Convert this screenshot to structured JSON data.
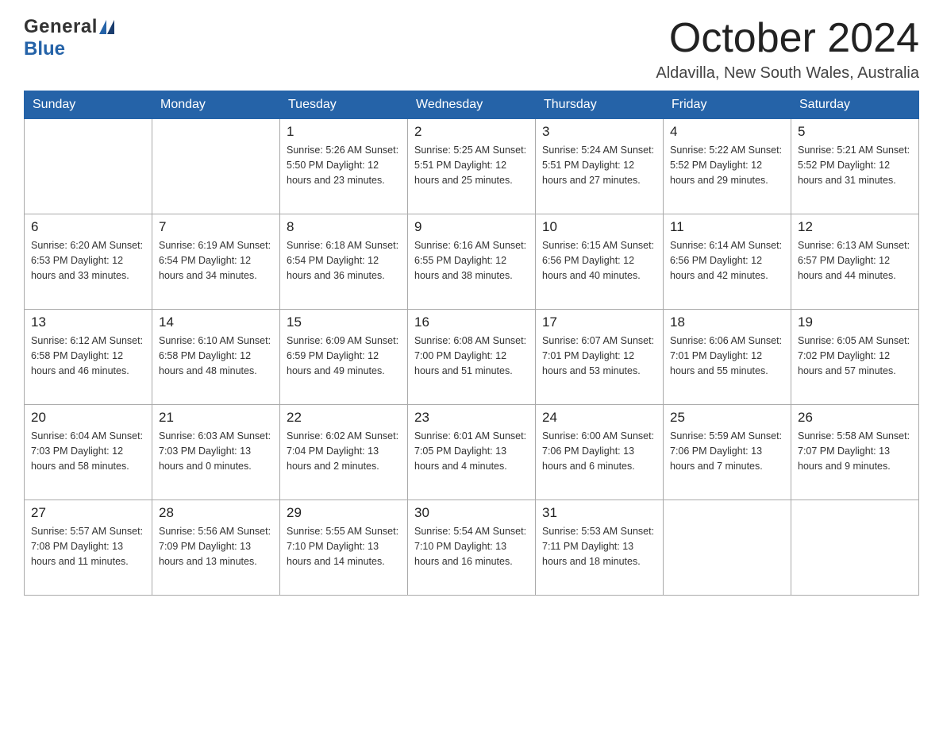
{
  "header": {
    "logo": {
      "text_general": "General",
      "text_blue": "Blue"
    },
    "title": "October 2024",
    "location": "Aldavilla, New South Wales, Australia"
  },
  "weekdays": [
    "Sunday",
    "Monday",
    "Tuesday",
    "Wednesday",
    "Thursday",
    "Friday",
    "Saturday"
  ],
  "weeks": [
    [
      {
        "day": "",
        "info": ""
      },
      {
        "day": "",
        "info": ""
      },
      {
        "day": "1",
        "info": "Sunrise: 5:26 AM\nSunset: 5:50 PM\nDaylight: 12 hours\nand 23 minutes."
      },
      {
        "day": "2",
        "info": "Sunrise: 5:25 AM\nSunset: 5:51 PM\nDaylight: 12 hours\nand 25 minutes."
      },
      {
        "day": "3",
        "info": "Sunrise: 5:24 AM\nSunset: 5:51 PM\nDaylight: 12 hours\nand 27 minutes."
      },
      {
        "day": "4",
        "info": "Sunrise: 5:22 AM\nSunset: 5:52 PM\nDaylight: 12 hours\nand 29 minutes."
      },
      {
        "day": "5",
        "info": "Sunrise: 5:21 AM\nSunset: 5:52 PM\nDaylight: 12 hours\nand 31 minutes."
      }
    ],
    [
      {
        "day": "6",
        "info": "Sunrise: 6:20 AM\nSunset: 6:53 PM\nDaylight: 12 hours\nand 33 minutes."
      },
      {
        "day": "7",
        "info": "Sunrise: 6:19 AM\nSunset: 6:54 PM\nDaylight: 12 hours\nand 34 minutes."
      },
      {
        "day": "8",
        "info": "Sunrise: 6:18 AM\nSunset: 6:54 PM\nDaylight: 12 hours\nand 36 minutes."
      },
      {
        "day": "9",
        "info": "Sunrise: 6:16 AM\nSunset: 6:55 PM\nDaylight: 12 hours\nand 38 minutes."
      },
      {
        "day": "10",
        "info": "Sunrise: 6:15 AM\nSunset: 6:56 PM\nDaylight: 12 hours\nand 40 minutes."
      },
      {
        "day": "11",
        "info": "Sunrise: 6:14 AM\nSunset: 6:56 PM\nDaylight: 12 hours\nand 42 minutes."
      },
      {
        "day": "12",
        "info": "Sunrise: 6:13 AM\nSunset: 6:57 PM\nDaylight: 12 hours\nand 44 minutes."
      }
    ],
    [
      {
        "day": "13",
        "info": "Sunrise: 6:12 AM\nSunset: 6:58 PM\nDaylight: 12 hours\nand 46 minutes."
      },
      {
        "day": "14",
        "info": "Sunrise: 6:10 AM\nSunset: 6:58 PM\nDaylight: 12 hours\nand 48 minutes."
      },
      {
        "day": "15",
        "info": "Sunrise: 6:09 AM\nSunset: 6:59 PM\nDaylight: 12 hours\nand 49 minutes."
      },
      {
        "day": "16",
        "info": "Sunrise: 6:08 AM\nSunset: 7:00 PM\nDaylight: 12 hours\nand 51 minutes."
      },
      {
        "day": "17",
        "info": "Sunrise: 6:07 AM\nSunset: 7:01 PM\nDaylight: 12 hours\nand 53 minutes."
      },
      {
        "day": "18",
        "info": "Sunrise: 6:06 AM\nSunset: 7:01 PM\nDaylight: 12 hours\nand 55 minutes."
      },
      {
        "day": "19",
        "info": "Sunrise: 6:05 AM\nSunset: 7:02 PM\nDaylight: 12 hours\nand 57 minutes."
      }
    ],
    [
      {
        "day": "20",
        "info": "Sunrise: 6:04 AM\nSunset: 7:03 PM\nDaylight: 12 hours\nand 58 minutes."
      },
      {
        "day": "21",
        "info": "Sunrise: 6:03 AM\nSunset: 7:03 PM\nDaylight: 13 hours\nand 0 minutes."
      },
      {
        "day": "22",
        "info": "Sunrise: 6:02 AM\nSunset: 7:04 PM\nDaylight: 13 hours\nand 2 minutes."
      },
      {
        "day": "23",
        "info": "Sunrise: 6:01 AM\nSunset: 7:05 PM\nDaylight: 13 hours\nand 4 minutes."
      },
      {
        "day": "24",
        "info": "Sunrise: 6:00 AM\nSunset: 7:06 PM\nDaylight: 13 hours\nand 6 minutes."
      },
      {
        "day": "25",
        "info": "Sunrise: 5:59 AM\nSunset: 7:06 PM\nDaylight: 13 hours\nand 7 minutes."
      },
      {
        "day": "26",
        "info": "Sunrise: 5:58 AM\nSunset: 7:07 PM\nDaylight: 13 hours\nand 9 minutes."
      }
    ],
    [
      {
        "day": "27",
        "info": "Sunrise: 5:57 AM\nSunset: 7:08 PM\nDaylight: 13 hours\nand 11 minutes."
      },
      {
        "day": "28",
        "info": "Sunrise: 5:56 AM\nSunset: 7:09 PM\nDaylight: 13 hours\nand 13 minutes."
      },
      {
        "day": "29",
        "info": "Sunrise: 5:55 AM\nSunset: 7:10 PM\nDaylight: 13 hours\nand 14 minutes."
      },
      {
        "day": "30",
        "info": "Sunrise: 5:54 AM\nSunset: 7:10 PM\nDaylight: 13 hours\nand 16 minutes."
      },
      {
        "day": "31",
        "info": "Sunrise: 5:53 AM\nSunset: 7:11 PM\nDaylight: 13 hours\nand 18 minutes."
      },
      {
        "day": "",
        "info": ""
      },
      {
        "day": "",
        "info": ""
      }
    ]
  ]
}
